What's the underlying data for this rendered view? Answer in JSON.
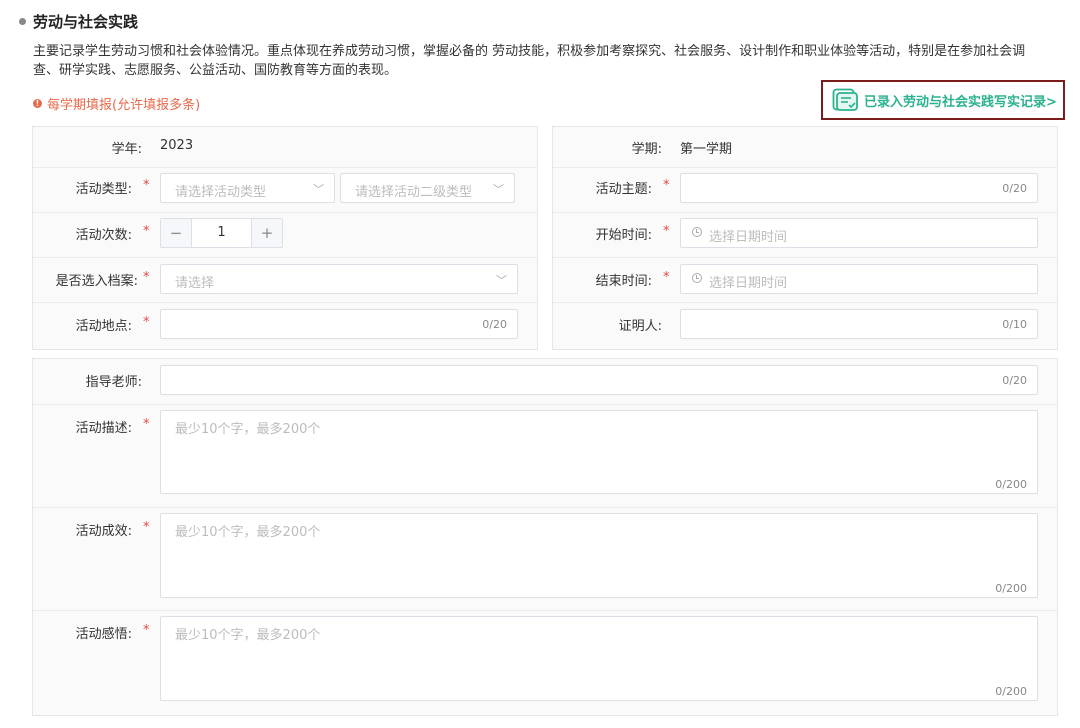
{
  "section": {
    "title": "劳动与社会实践",
    "description": "主要记录学生劳动习惯和社会体验情况。重点体现在养成劳动习惯，掌握必备的 劳动技能，积极参加考察探究、社会服务、设计制作和职业体验等活动，特别是在参加社会调查、研学实践、志愿服务、公益活动、国防教育等方面的表现。",
    "notice": "每学期填报(允许填报多条)",
    "notice_icon": "!",
    "record_link": "已录入劳动与社会实践写实记录>",
    "accent_color": "#2bb28f"
  },
  "form": {
    "required_mark": "*",
    "year": {
      "label": "学年:",
      "value": "2023"
    },
    "term": {
      "label": "学期:",
      "value": "第一学期"
    },
    "activity_type": {
      "label": "活动类型:",
      "placeholder": "请选择活动类型",
      "placeholder2": "请选择活动二级类型"
    },
    "activity_theme": {
      "label": "活动主题:",
      "counter": "0/20"
    },
    "activity_count": {
      "label": "活动次数:",
      "value": "1",
      "minus": "−",
      "plus": "+"
    },
    "start_time": {
      "label": "开始时间:",
      "placeholder": "选择日期时间"
    },
    "archive": {
      "label": "是否选入档案:",
      "placeholder": "请选择"
    },
    "end_time": {
      "label": "结束时间:",
      "placeholder": "选择日期时间"
    },
    "location": {
      "label": "活动地点:",
      "counter": "0/20"
    },
    "witness": {
      "label": "证明人:",
      "counter": "0/10"
    },
    "teacher": {
      "label": "指导老师:",
      "counter": "0/20"
    },
    "description": {
      "label": "活动描述:",
      "placeholder": "最少10个字，最多200个",
      "counter": "0/200"
    },
    "effect": {
      "label": "活动成效:",
      "placeholder": "最少10个字，最多200个",
      "counter": "0/200"
    },
    "insight": {
      "label": "活动感悟:",
      "placeholder": "最少10个字，最多200个",
      "counter": "0/200"
    }
  }
}
